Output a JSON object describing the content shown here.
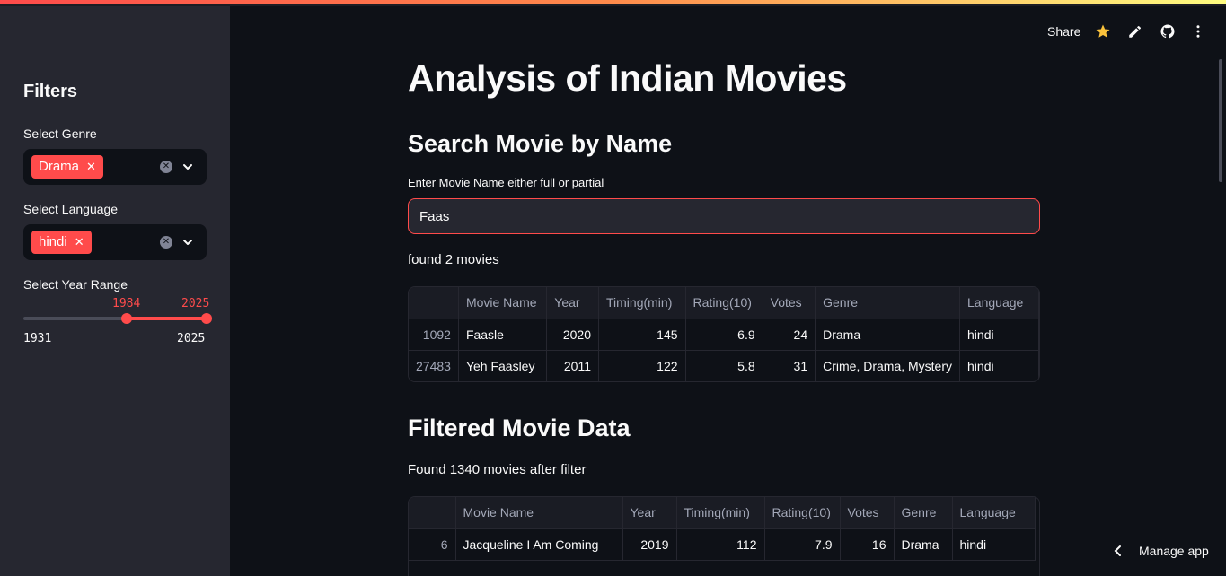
{
  "sidebar": {
    "title": "Filters",
    "genre": {
      "label": "Select Genre",
      "tag": "Drama"
    },
    "language": {
      "label": "Select Language",
      "tag": "hindi"
    },
    "year": {
      "label": "Select Year Range",
      "low": "1984",
      "high": "2025",
      "min": "1931",
      "max": "2025",
      "low_value": 1984,
      "high_value": 2025,
      "min_value": 1931,
      "max_value": 2025
    }
  },
  "toolbar": {
    "share_label": "Share",
    "icons": [
      "star-icon",
      "edit-icon",
      "github-icon",
      "more-icon"
    ]
  },
  "main": {
    "title": "Analysis of Indian Movies",
    "search": {
      "heading": "Search Movie by Name",
      "input_label": "Enter Movie Name either full or partial",
      "input_value": "Faas",
      "result_text": "found 2 movies",
      "columns": [
        "",
        "Movie Name",
        "Year",
        "Timing(min)",
        "Rating(10)",
        "Votes",
        "Genre",
        "Language"
      ],
      "rows": [
        [
          "1092",
          "Faasle",
          "2020",
          "145",
          "6.9",
          "24",
          "Drama",
          "hindi"
        ],
        [
          "27483",
          "Yeh Faasley",
          "2011",
          "122",
          "5.8",
          "31",
          "Crime, Drama, Mystery",
          "hindi"
        ]
      ]
    },
    "filtered": {
      "heading": "Filtered Movie Data",
      "result_text": "Found 1340 movies after filter",
      "columns": [
        "",
        "Movie Name",
        "Year",
        "Timing(min)",
        "Rating(10)",
        "Votes",
        "Genre",
        "Language"
      ],
      "rows": [
        [
          "6",
          "Jacqueline I Am Coming",
          "2019",
          "112",
          "7.9",
          "16",
          "Drama",
          "hindi"
        ]
      ]
    }
  },
  "footer": {
    "manage_label": "Manage app"
  },
  "colors": {
    "accent": "#ff4b4b",
    "background": "#0e1117",
    "sidebar": "#262730"
  }
}
